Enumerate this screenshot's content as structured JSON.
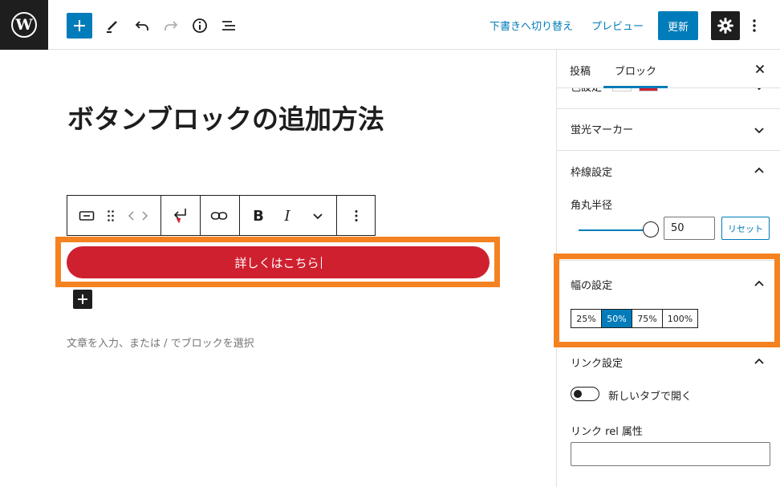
{
  "header": {
    "logo_letter": "W",
    "draft_switch_label": "下書きへ切り替え",
    "preview_label": "プレビュー",
    "update_label": "更新"
  },
  "editor": {
    "post_title": "ボタンブロックの追加方法",
    "button_text": "詳しくはこちら",
    "placeholder": "文章を入力、または / でブロックを選択",
    "toolbar_bold": "B",
    "toolbar_italic": "I"
  },
  "sidebar": {
    "tabs": [
      {
        "label": "投稿",
        "active": false
      },
      {
        "label": "ブロック",
        "active": true
      }
    ],
    "partial_panel_title": "色設定",
    "partial_swatches": [
      "#ffffff",
      "#cf2030"
    ],
    "panels": {
      "highlighter": {
        "title": "蛍光マーカー",
        "expanded": false
      },
      "border": {
        "title": "枠線設定",
        "expanded": true,
        "radius_label": "角丸半径",
        "radius_value": "50",
        "radius_fraction": 0.5,
        "reset_label": "リセット"
      },
      "width": {
        "title": "幅の設定",
        "expanded": true,
        "options": [
          "25%",
          "50%",
          "75%",
          "100%"
        ],
        "selected": "50%"
      },
      "link": {
        "title": "リンク設定",
        "expanded": true,
        "new_tab_label": "新しいタブで開く",
        "new_tab_enabled": false,
        "rel_label": "リンク rel 属性",
        "rel_value": ""
      }
    }
  },
  "colors": {
    "accent": "#007cba",
    "button_bg": "#cf2030",
    "highlight": "#f58220",
    "dark": "#1e1e1e"
  }
}
